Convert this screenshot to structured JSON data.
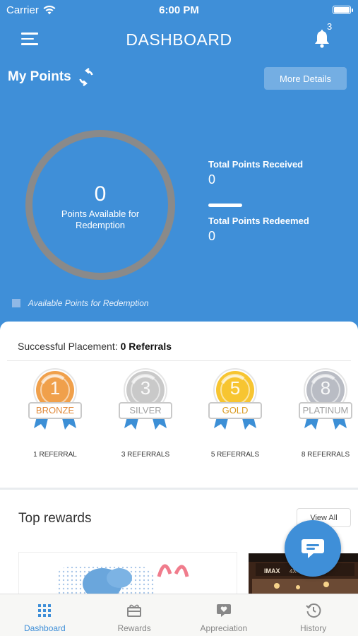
{
  "status_bar": {
    "carrier": "Carrier",
    "time": "6:00 PM"
  },
  "header": {
    "title": "DASHBOARD",
    "notification_count": "3"
  },
  "points": {
    "heading": "My Points",
    "more_details": "More Details",
    "available": "0",
    "available_label": "Points Available for Redemption",
    "total_received_label": "Total Points Received",
    "total_received": "0",
    "total_redeemed_label": "Total Points Redeemed",
    "total_redeemed": "0",
    "legend": "Available Points for Redemption"
  },
  "placement": {
    "label": "Successful Placement:",
    "value": "0 Referrals",
    "medals": [
      {
        "number": "1",
        "tier": "BRONZE",
        "caption": "1 REFERRAL",
        "color": "#f0a04b"
      },
      {
        "number": "3",
        "tier": "SILVER",
        "caption": "3 REFERRALS",
        "color": "#c9c9c9"
      },
      {
        "number": "5",
        "tier": "GOLD",
        "caption": "5 REFERRALS",
        "color": "#f7c531"
      },
      {
        "number": "8",
        "tier": "PLATINUM",
        "caption": "8 REFERRALS",
        "color": "#b9bcc4"
      }
    ]
  },
  "rewards": {
    "heading": "Top rewards",
    "view_all": "View All"
  },
  "tabs": [
    {
      "label": "Dashboard",
      "icon": "grid-icon",
      "active": true
    },
    {
      "label": "Rewards",
      "icon": "gift-icon",
      "active": false
    },
    {
      "label": "Appreciation",
      "icon": "heart-chat-icon",
      "active": false
    },
    {
      "label": "History",
      "icon": "history-icon",
      "active": false
    }
  ],
  "colors": {
    "primary": "#3f8fd8",
    "ring": "#8a8a8a"
  }
}
